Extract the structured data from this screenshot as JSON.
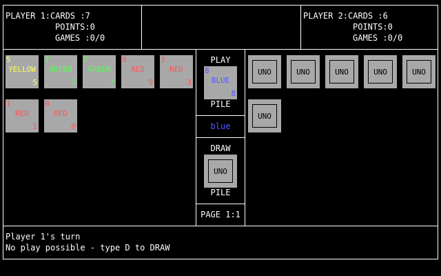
{
  "player1": {
    "line1": "PLAYER 1:CARDS :7",
    "line2": "POINTS:0",
    "line3": "GAMES :0/0"
  },
  "player2": {
    "line1": "PLAYER 2:CARDS :6",
    "line2": "POINTS:0",
    "line3": "GAMES :0/0"
  },
  "hand1": [
    {
      "num": "5",
      "name": "YELLOW",
      "color": "#ffff55"
    },
    {
      "num": "7",
      "name": "GREEN",
      "color": "#55ff55"
    },
    {
      "num": "7",
      "name": "GREEN",
      "color": "#55ff55"
    },
    {
      "num": "9",
      "name": "RED",
      "color": "#ff5555"
    },
    {
      "num": "3",
      "name": "RED",
      "color": "#ff5555"
    },
    {
      "num": "1",
      "name": "RED",
      "color": "#ff5555"
    },
    {
      "num": "0",
      "name": "RED",
      "color": "#ff5555"
    }
  ],
  "hand2_back_label": "UNO",
  "play_pile": {
    "top_label": "PLAY",
    "bottom_label": "PILE",
    "card": {
      "num": "8",
      "name": "BLUE",
      "color": "#5555ff"
    }
  },
  "current_color": {
    "label": "blue",
    "color": "#5555ff"
  },
  "draw_pile": {
    "top_label": "DRAW",
    "bottom_label": "PILE",
    "card_label": "UNO"
  },
  "page": "PAGE 1:1",
  "status": {
    "line1": "Player 1's turn",
    "line2": "No play possible - type D to DRAW"
  }
}
